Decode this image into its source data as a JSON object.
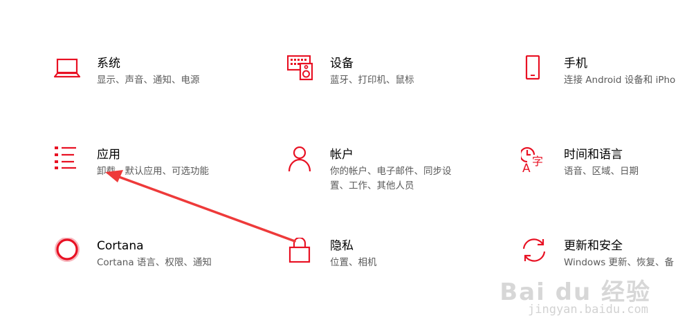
{
  "accent_color": "#e81123",
  "tiles": [
    {
      "icon": "laptop-icon",
      "title": "系统",
      "desc_lines": [
        "显示、声音、通知、电源"
      ]
    },
    {
      "icon": "keyboard-speaker-icon",
      "title": "设备",
      "desc_lines": [
        "蓝牙、打印机、鼠标"
      ]
    },
    {
      "icon": "phone-icon",
      "title": "手机",
      "desc_lines": [
        "连接 Android 设备和 iPho"
      ]
    },
    {
      "icon": "apps-list-icon",
      "title": "应用",
      "desc_lines": [
        "卸载、默认应用、可选功能"
      ]
    },
    {
      "icon": "person-icon",
      "title": "帐户",
      "desc_lines": [
        "你的帐户、电子邮件、同步设",
        "置、工作、其他人员"
      ]
    },
    {
      "icon": "time-language-icon",
      "title": "时间和语言",
      "desc_lines": [
        "语音、区域、日期"
      ]
    },
    {
      "icon": "cortana-icon",
      "title": "Cortana",
      "desc_lines": [
        "Cortana 语言、权限、通知"
      ]
    },
    {
      "icon": "lock-icon",
      "title": "隐私",
      "desc_lines": [
        "位置、相机"
      ]
    },
    {
      "icon": "sync-update-icon",
      "title": "更新和安全",
      "desc_lines": [
        "Windows 更新、恢复、备"
      ]
    }
  ],
  "annotation": {
    "icon": "red-arrow-icon",
    "color": "#ee3a3a"
  },
  "watermark": {
    "logo": "Bai du 经验",
    "url": "jingyan.baidu.com"
  }
}
